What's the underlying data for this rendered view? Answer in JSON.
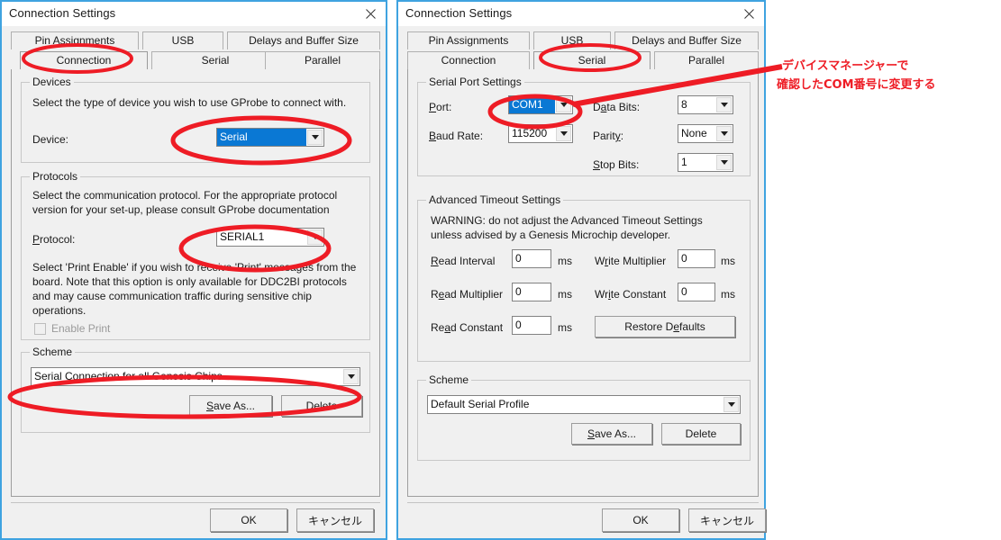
{
  "colors": {
    "dialog_border": "#3fa3e0",
    "dialog_bg": "#f0f0f0",
    "selection_blue": "#0a78d4",
    "annotation_red": "#ee1c25"
  },
  "left_dialog": {
    "title": "Connection Settings",
    "close_icon": "close-icon",
    "tabs_row1": [
      {
        "label": "Pin Assignments",
        "selected": false
      },
      {
        "label": "USB",
        "selected": false
      },
      {
        "label": "Delays and Buffer Size",
        "selected": false
      }
    ],
    "tabs_row2": [
      {
        "label": "Connection",
        "selected": true
      },
      {
        "label": "Serial",
        "selected": false
      },
      {
        "label": "Parallel",
        "selected": false
      }
    ],
    "devices_group": {
      "legend": "Devices",
      "description": "Select the type of device you wish to use GProbe to connect with.",
      "device_label": "Device:",
      "device_value": "Serial"
    },
    "protocols_group": {
      "legend": "Protocols",
      "description_line1": "Select the communication protocol.  For the appropriate protocol",
      "description_line2": "version for your set-up, please consult GProbe documentation",
      "protocol_label": "Protocol:",
      "protocol_label_accel": "P",
      "protocol_value": "SERIAL1",
      "note_line1": "Select 'Print Enable' if you wish to receive 'Print' messages from the",
      "note_line2": "board.   Note that this option is only available for DDC2BI protocols",
      "note_line3": "and may cause communication traffic during sensitive chip",
      "note_line4": "operations.",
      "enable_print_label": "Enable Print",
      "enable_print_checked": false,
      "enable_print_disabled": true
    },
    "scheme_group": {
      "legend": "Scheme",
      "value": "Serial Connection for all Genesis Chips",
      "save_as_label": "Save As...",
      "save_as_accel": "S",
      "delete_label": "Delete"
    },
    "footer": {
      "ok_label": "OK",
      "cancel_label": "キャンセル"
    }
  },
  "right_dialog": {
    "title": "Connection Settings",
    "close_icon": "close-icon",
    "tabs_row1": [
      {
        "label": "Pin Assignments",
        "selected": false
      },
      {
        "label": "USB",
        "selected": false
      },
      {
        "label": "Delays and Buffer Size",
        "selected": false
      }
    ],
    "tabs_row2": [
      {
        "label": "Connection",
        "selected": false
      },
      {
        "label": "Serial",
        "selected": true
      },
      {
        "label": "Parallel",
        "selected": false
      }
    ],
    "serial_port_group": {
      "legend": "Serial Port Settings",
      "port_label": "Port:",
      "port_accel": "P",
      "port_value": "COM1",
      "baud_label": "Baud Rate:",
      "baud_accel": "B",
      "baud_value": "115200",
      "data_bits_label": "Data Bits:",
      "data_bits_accel": "a",
      "data_bits_value": "8",
      "parity_label": "Parity:",
      "parity_accel": "y",
      "parity_value": "None",
      "stop_bits_label": "Stop Bits:",
      "stop_bits_accel": "S",
      "stop_bits_value": "1"
    },
    "timeout_group": {
      "legend": "Advanced Timeout Settings",
      "warning_line1": "WARNING: do not adjust the Advanced Timeout Settings",
      "warning_line2": "unless advised by a Genesis Microchip developer.",
      "read_interval_label": "Read Interval",
      "read_interval_value": "0",
      "read_interval_unit": "ms",
      "read_multiplier_label": "Read Multiplier",
      "read_multiplier_value": "0",
      "read_multiplier_unit": "ms",
      "read_constant_label": "Read Constant",
      "read_constant_value": "0",
      "read_constant_unit": "ms",
      "write_multiplier_label": "Write Multiplier",
      "write_multiplier_value": "0",
      "write_multiplier_unit": "ms",
      "write_constant_label": "Write Constant",
      "write_constant_value": "0",
      "write_constant_unit": "ms",
      "restore_defaults_label": "Restore Defaults"
    },
    "scheme_group": {
      "legend": "Scheme",
      "value": "Default Serial Profile",
      "save_as_label": "Save As...",
      "delete_label": "Delete"
    },
    "footer": {
      "ok_label": "OK",
      "cancel_label": "キャンセル"
    }
  },
  "annotation": {
    "line1": "デバイスマネージャーで",
    "line2": "確認したCOM番号に変更する"
  }
}
